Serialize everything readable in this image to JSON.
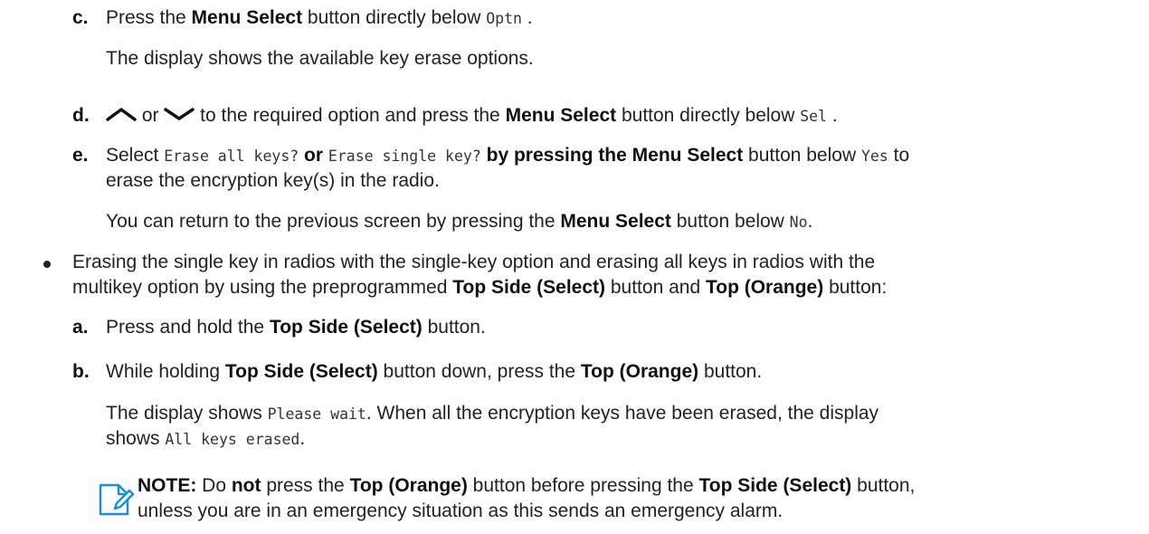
{
  "step_c": {
    "label": "c.",
    "pre": "Press the ",
    "bold": "Menu Select",
    "mid": " button directly below ",
    "code": "Optn",
    "post": " .",
    "result": "The display shows the available key erase options."
  },
  "step_d": {
    "label": "d.",
    "or": " or ",
    "mid": " to the required option and press the ",
    "bold": "Menu Select",
    "mid2": " button directly below ",
    "code": "Sel",
    "post": " .",
    "up_icon": "chevron-up-icon",
    "down_icon": "chevron-down-icon"
  },
  "step_e": {
    "label": "e.",
    "pre": "Select ",
    "code1": "Erase all keys?",
    "or": " or ",
    "code2": "Erase single key?",
    "mid": " by pressing the ",
    "bold": "Menu Select",
    "mid2": " button below ",
    "code3": "Yes",
    "post": " to",
    "line2": "erase the encryption key(s) in the radio.",
    "return_pre": "You can return to the previous screen by pressing the ",
    "return_bold": "Menu Select",
    "return_mid": " button below ",
    "return_code": "No",
    "return_post": "."
  },
  "bullet": {
    "line1": "Erasing the single key in radios with the single-key option and erasing all keys in radios with the",
    "line2_pre": "multikey option by using the preprogrammed ",
    "bold1": "Top Side (Select)",
    "line2_mid": " button and ",
    "bold2": "Top (Orange)",
    "line2_post": " button:"
  },
  "sub_a": {
    "label": "a.",
    "pre": "Press and hold the ",
    "bold": "Top Side (Select)",
    "post": " button."
  },
  "sub_b": {
    "label": "b.",
    "pre": "While holding ",
    "bold1": "Top Side (Select)",
    "mid": " button down, press the ",
    "bold2": "Top (Orange)",
    "post": " button.",
    "result_pre": "The display shows ",
    "result_code1": "Please wait",
    "result_mid": ". When all the encryption keys have been erased, the display",
    "result_line2_pre": "shows ",
    "result_code2": "All keys erased",
    "result_post": "."
  },
  "note": {
    "icon": "note-icon",
    "label": "NOTE:",
    "pre": " Do ",
    "bold_not": "not",
    "mid": " press the ",
    "bold1": "Top (Orange)",
    "mid2": " button before pressing the ",
    "bold2": "Top Side (Select)",
    "post": " button,",
    "line2": "unless you are in an emergency situation as this sends an emergency alarm."
  }
}
